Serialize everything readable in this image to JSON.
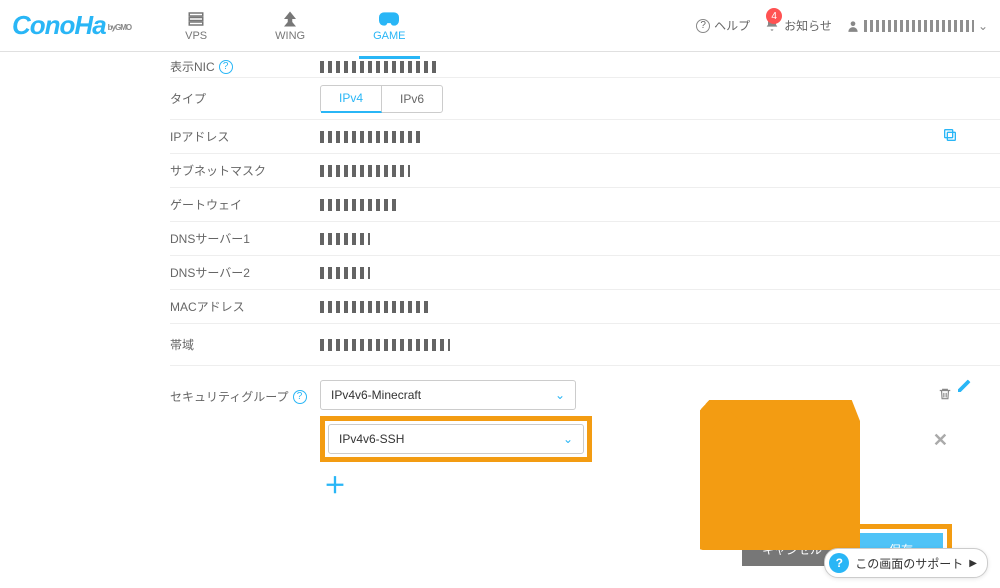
{
  "logo": "ConoHa",
  "logo_sub": "byGMO",
  "nav": {
    "vps": "VPS",
    "wing": "WING",
    "game": "GAME"
  },
  "header_right": {
    "help": "ヘルプ",
    "notice": "お知らせ",
    "badge": "4"
  },
  "rows": {
    "nic": "表示NIC",
    "type": "タイプ",
    "ip": "IPアドレス",
    "subnet": "サブネットマスク",
    "gateway": "ゲートウェイ",
    "dns1": "DNSサーバー1",
    "dns2": "DNSサーバー2",
    "mac": "MACアドレス",
    "band": "帯域",
    "secgroup": "セキュリティグループ"
  },
  "tabs": {
    "ipv4": "IPv4",
    "ipv6": "IPv6"
  },
  "selects": {
    "sg1": "IPv4v6-Minecraft",
    "sg2": "IPv4v6-SSH"
  },
  "buttons": {
    "cancel": "キャンセル",
    "save": "保存"
  },
  "support": "この画面のサポート"
}
